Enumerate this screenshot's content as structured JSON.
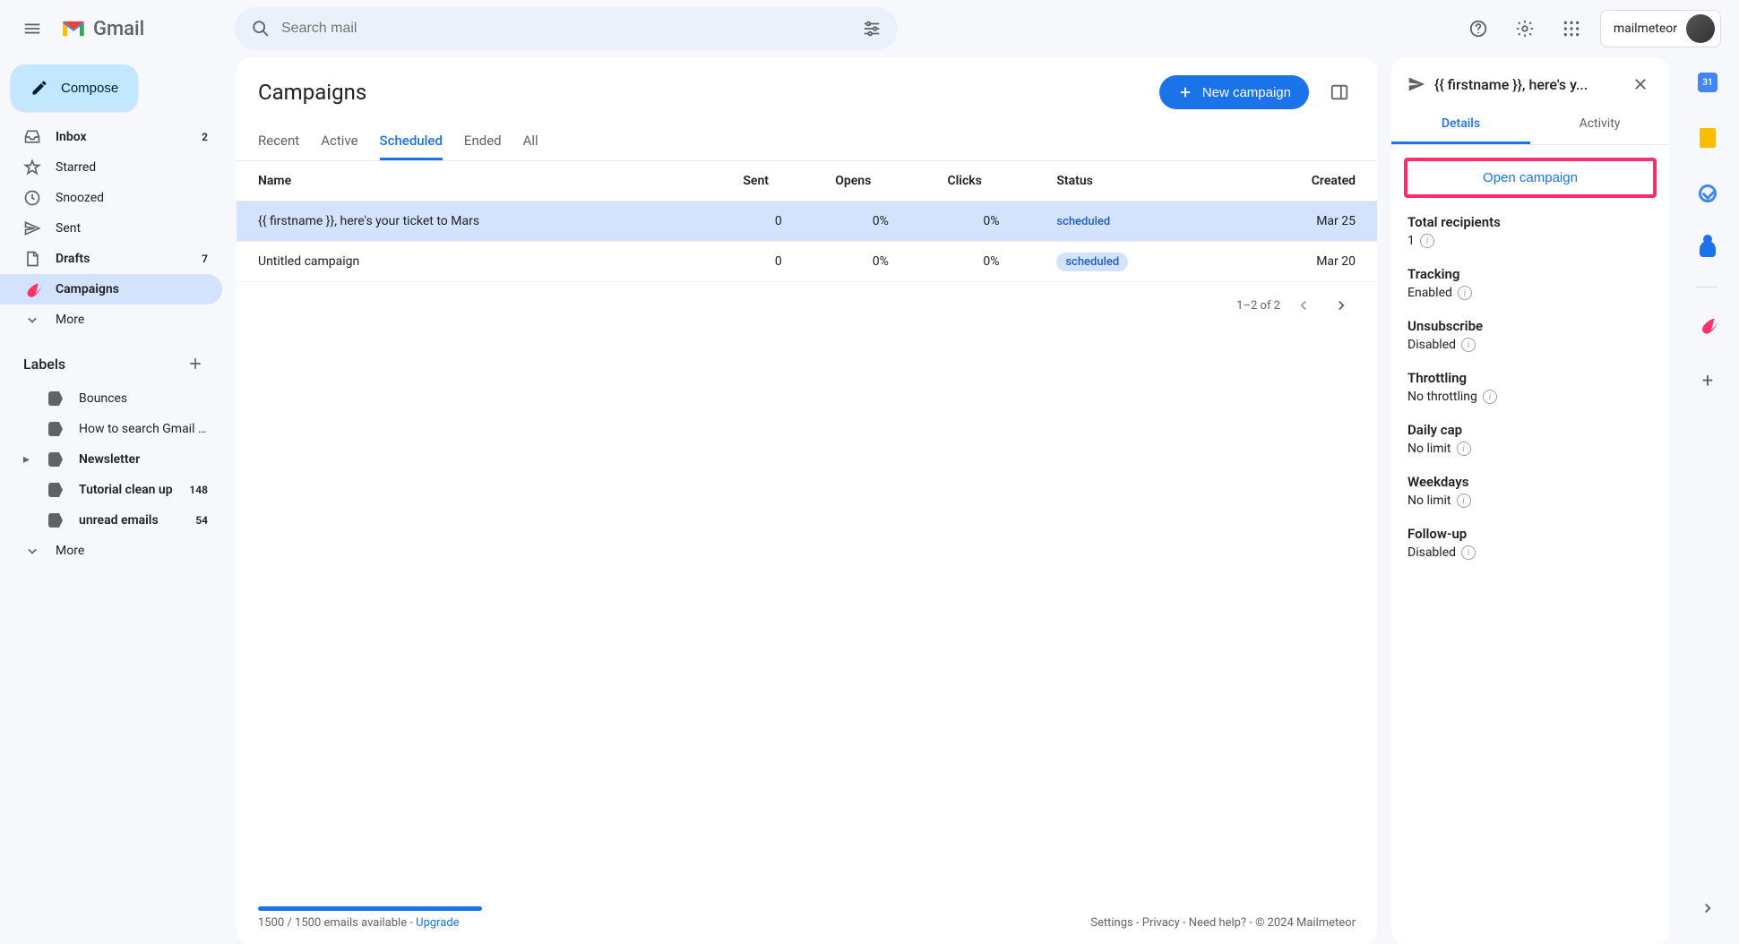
{
  "header": {
    "product": "Gmail",
    "search_placeholder": "Search mail",
    "account_label": "mailmeteor"
  },
  "sidebar": {
    "compose": "Compose",
    "items": [
      {
        "icon": "inbox",
        "label": "Inbox",
        "count": "2",
        "bold": true
      },
      {
        "icon": "star",
        "label": "Starred"
      },
      {
        "icon": "clock",
        "label": "Snoozed"
      },
      {
        "icon": "send",
        "label": "Sent"
      },
      {
        "icon": "file",
        "label": "Drafts",
        "count": "7",
        "bold": true
      },
      {
        "icon": "campaign",
        "label": "Campaigns",
        "active": true,
        "bold": true
      },
      {
        "icon": "chevron",
        "label": "More"
      }
    ],
    "labels_header": "Labels",
    "labels": [
      {
        "label": "Bounces"
      },
      {
        "label": "How to search Gmail by ..."
      },
      {
        "label": "Newsletter",
        "bold": true,
        "expandable": true
      },
      {
        "label": "Tutorial clean up",
        "count": "148",
        "bold": true
      },
      {
        "label": "unread emails",
        "count": "54",
        "bold": true
      },
      {
        "icon": "chevron",
        "label": "More"
      }
    ]
  },
  "main": {
    "title": "Campaigns",
    "new_button": "New campaign",
    "tabs": [
      "Recent",
      "Active",
      "Scheduled",
      "Ended",
      "All"
    ],
    "active_tab": 2,
    "columns": [
      "Name",
      "Sent",
      "Opens",
      "Clicks",
      "Status",
      "Created"
    ],
    "rows": [
      {
        "name": "{{ firstname }}, here's your ticket to Mars",
        "sent": "0",
        "opens": "0%",
        "clicks": "0%",
        "status": "scheduled",
        "created": "Mar 25",
        "selected": true,
        "status_style": "text"
      },
      {
        "name": "Untitled campaign",
        "sent": "0",
        "opens": "0%",
        "clicks": "0%",
        "status": "scheduled",
        "created": "Mar 20",
        "status_style": "pill"
      }
    ],
    "pagination": "1–2 of 2",
    "quota_text": "1500 / 1500 emails available - ",
    "upgrade": "Upgrade",
    "footer_links": "Settings - Privacy - Need help? - © 2024 Mailmeteor"
  },
  "details": {
    "title": "{{ firstname }}, here's y...",
    "tabs": [
      "Details",
      "Activity"
    ],
    "active_tab": 0,
    "open_button": "Open campaign",
    "items": [
      {
        "k": "Total recipients",
        "v": "1",
        "info": true
      },
      {
        "k": "Tracking",
        "v": "Enabled",
        "info": true
      },
      {
        "k": "Unsubscribe",
        "v": "Disabled",
        "info": true
      },
      {
        "k": "Throttling",
        "v": "No throttling",
        "info": true
      },
      {
        "k": "Daily cap",
        "v": "No limit",
        "info": true
      },
      {
        "k": "Weekdays",
        "v": "No limit",
        "info": true
      },
      {
        "k": "Follow-up",
        "v": "Disabled",
        "info": true
      }
    ]
  }
}
